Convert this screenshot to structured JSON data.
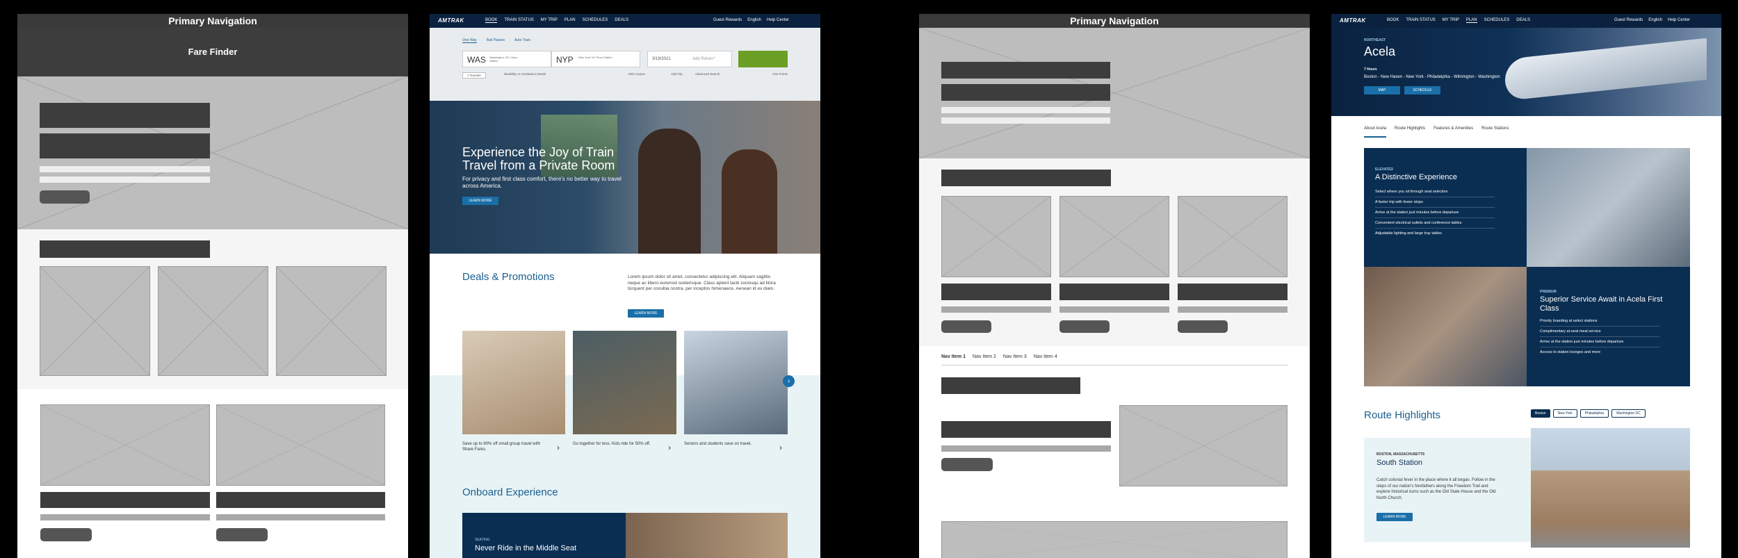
{
  "wf1": {
    "nav_title": "Primary Navigation",
    "hero_title": "Fare Finder"
  },
  "amtrak1": {
    "logo": "AMTRAK",
    "nav": [
      "BOOK",
      "TRAIN STATUS",
      "MY TRIP",
      "PLAN",
      "SCHEDULES",
      "DEALS"
    ],
    "nav_right": [
      "Guest Rewards",
      "English",
      "Help Center"
    ],
    "trip_types": [
      "One Way",
      "Rail Passes",
      "Auto Train"
    ],
    "from_code": "WAS",
    "from_name": "Washington, DC Union Station",
    "to_code": "NYP",
    "to_name": "New York, NY Penn Station",
    "depart_date": "3/19/2021",
    "return_placeholder": "Add Return*",
    "travelers": "1 Traveler",
    "disability": "Disability or Assistance Needs",
    "coupon": "Add Coupon",
    "add_trip": "Add Trip",
    "adv_search": "Advanced Search",
    "use_points": "Use Points",
    "hero_heading": "Experience the Joy of Train Travel from a Private Room",
    "hero_body": "For privacy and first class comfort, there's no better way to travel across America.",
    "hero_cta": "LEARN MORE",
    "deals_title": "Deals & Promotions",
    "deals_body": "Lorem ipsum dolor sit amet, consectetur adipiscing elit. Aliquam sagittis neque ac libero euismod scelerisque. Class aptent taciti sociosqu ad litora torquent per conubia nostra, per inceptos himenaeos. Aenean id ex diam.",
    "deals_cta": "LEARN MORE",
    "cards": [
      "Save up to 60% off small group travel with Share Fares.",
      "Go together for less. Kids ride for 50% off.",
      "Seniors and students save on travel."
    ],
    "onboard_title": "Onboard Experience",
    "seating_label": "SEATING",
    "seating_heading": "Never Ride in the Middle Seat"
  },
  "wf2": {
    "nav_title": "Primary Navigation",
    "tabs": [
      "Nav Item 1",
      "Nav Item 2",
      "Nav Item 3",
      "Nav Item 4"
    ]
  },
  "amtrak2": {
    "logo": "AMTRAK",
    "nav": [
      "BOOK",
      "TRAIN STATUS",
      "MY TRIP",
      "PLAN",
      "SCHEDULES",
      "DEALS"
    ],
    "nav_right": [
      "Guest Rewards",
      "English",
      "Help Center"
    ],
    "region": "NORTHEAST",
    "route_name": "Acela",
    "duration": "7 Hours",
    "stops": "Boston - New Haven - New York - Philadelphia - Wilmington - Washington",
    "btn_map": "MAP",
    "btn_schedule": "SCHEDULE",
    "tabs": [
      "About Acela",
      "Route Highlights",
      "Features & Amenities",
      "Route Stations"
    ],
    "elev_label": "ELEVATED",
    "elev_heading": "A Distinctive Experience",
    "elev_items": [
      "Select where you sit through seat selection",
      "A faster trip with fewer stops",
      "Arrive at the station just minutes before departure",
      "Convenient electrical outlets and conference tables",
      "Adjustable lighting and large tray tables"
    ],
    "prem_label": "PREMIUM",
    "prem_heading": "Superior Service Await in Acela First Class",
    "prem_items": [
      "Priority boarding at select stations",
      "Complimentary at-seat meal service",
      "Arrive at the station just minutes before departure",
      "Access to station lounges and more"
    ],
    "rh_title": "Route Highlights",
    "rh_tabs": [
      "Boston",
      "New York",
      "Philadelphia",
      "Washington DC"
    ],
    "station_loc": "BOSTON, MASSACHUSETTS",
    "station_name": "South Station",
    "station_body": "Catch colonial fever in the place where it all began. Follow in the steps of our nation's forefathers along the Freedom Trail and explore historical icons such as the Old State House and the Old North Church.",
    "station_cta": "LEARN MORE"
  }
}
